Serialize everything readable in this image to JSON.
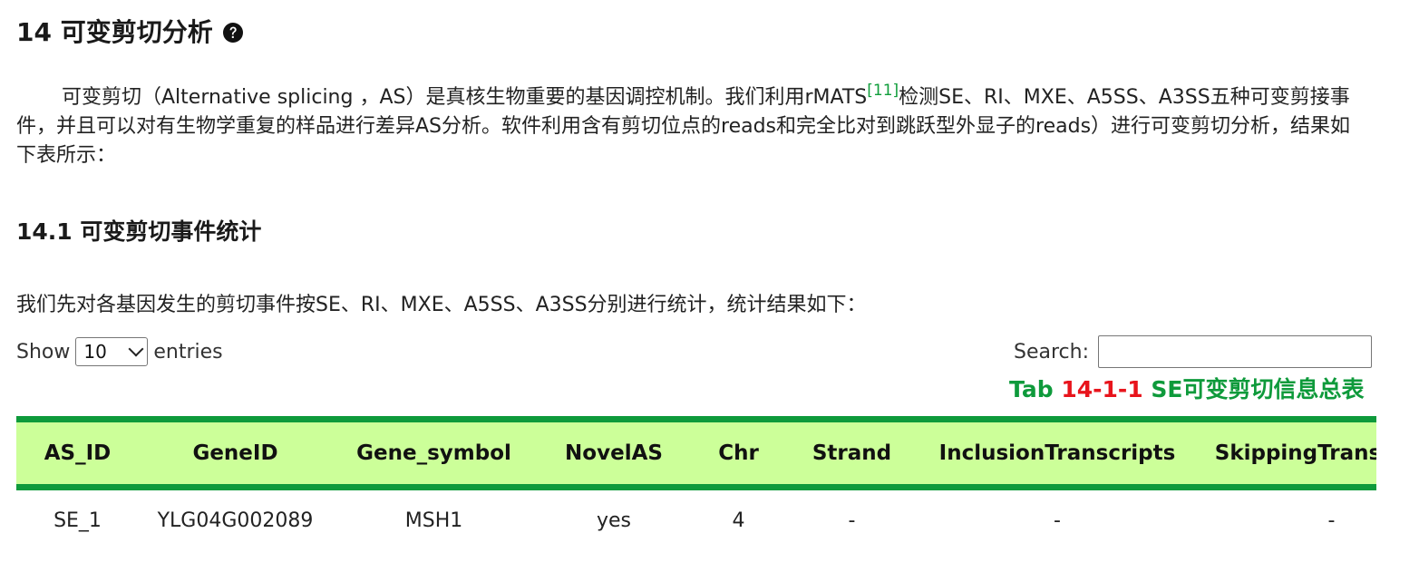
{
  "section": {
    "title": "14 可变剪切分析",
    "help_icon": "question-circle-icon"
  },
  "intro_paragraph": {
    "text_before_ref": "可变剪切（Alternative splicing ，AS）是真核生物重要的基因调控机制。我们利用rMATS",
    "reference": "[11]",
    "text_after_ref": "检测SE、RI、MXE、A5SS、A3SS五种可变剪接事件，并且可以对有生物学重复的样品进行差异AS分析。软件利用含有剪切位点的reads和完全比对到跳跃型外显子的reads）进行可变剪切分析，结果如下表所示："
  },
  "subsection": {
    "title": "14.1 可变剪切事件统计"
  },
  "stats_intro": "我们先对各基因发生的剪切事件按SE、RI、MXE、A5SS、A3SS分别进行统计，统计结果如下：",
  "length_control": {
    "prefix": "Show",
    "selected": "10",
    "suffix": "entries"
  },
  "search": {
    "label": "Search:",
    "value": ""
  },
  "table_caption": {
    "prefix": "Tab ",
    "number": "14-1-1",
    "title": " SE可变剪切信息总表"
  },
  "table": {
    "columns": [
      "AS_ID",
      "GeneID",
      "Gene_symbol",
      "NovelAS",
      "Chr",
      "Strand",
      "InclusionTranscripts",
      "SkippingTranscripts"
    ],
    "rows": [
      [
        "SE_1",
        "YLG04G002089",
        "MSH1",
        "yes",
        "4",
        "-",
        "-",
        "-"
      ]
    ]
  },
  "colors": {
    "accent_green": "#0e9a3b",
    "header_bg": "#ccff99",
    "caption_red": "#e8141c",
    "reference_green": "#0f9d3a"
  }
}
